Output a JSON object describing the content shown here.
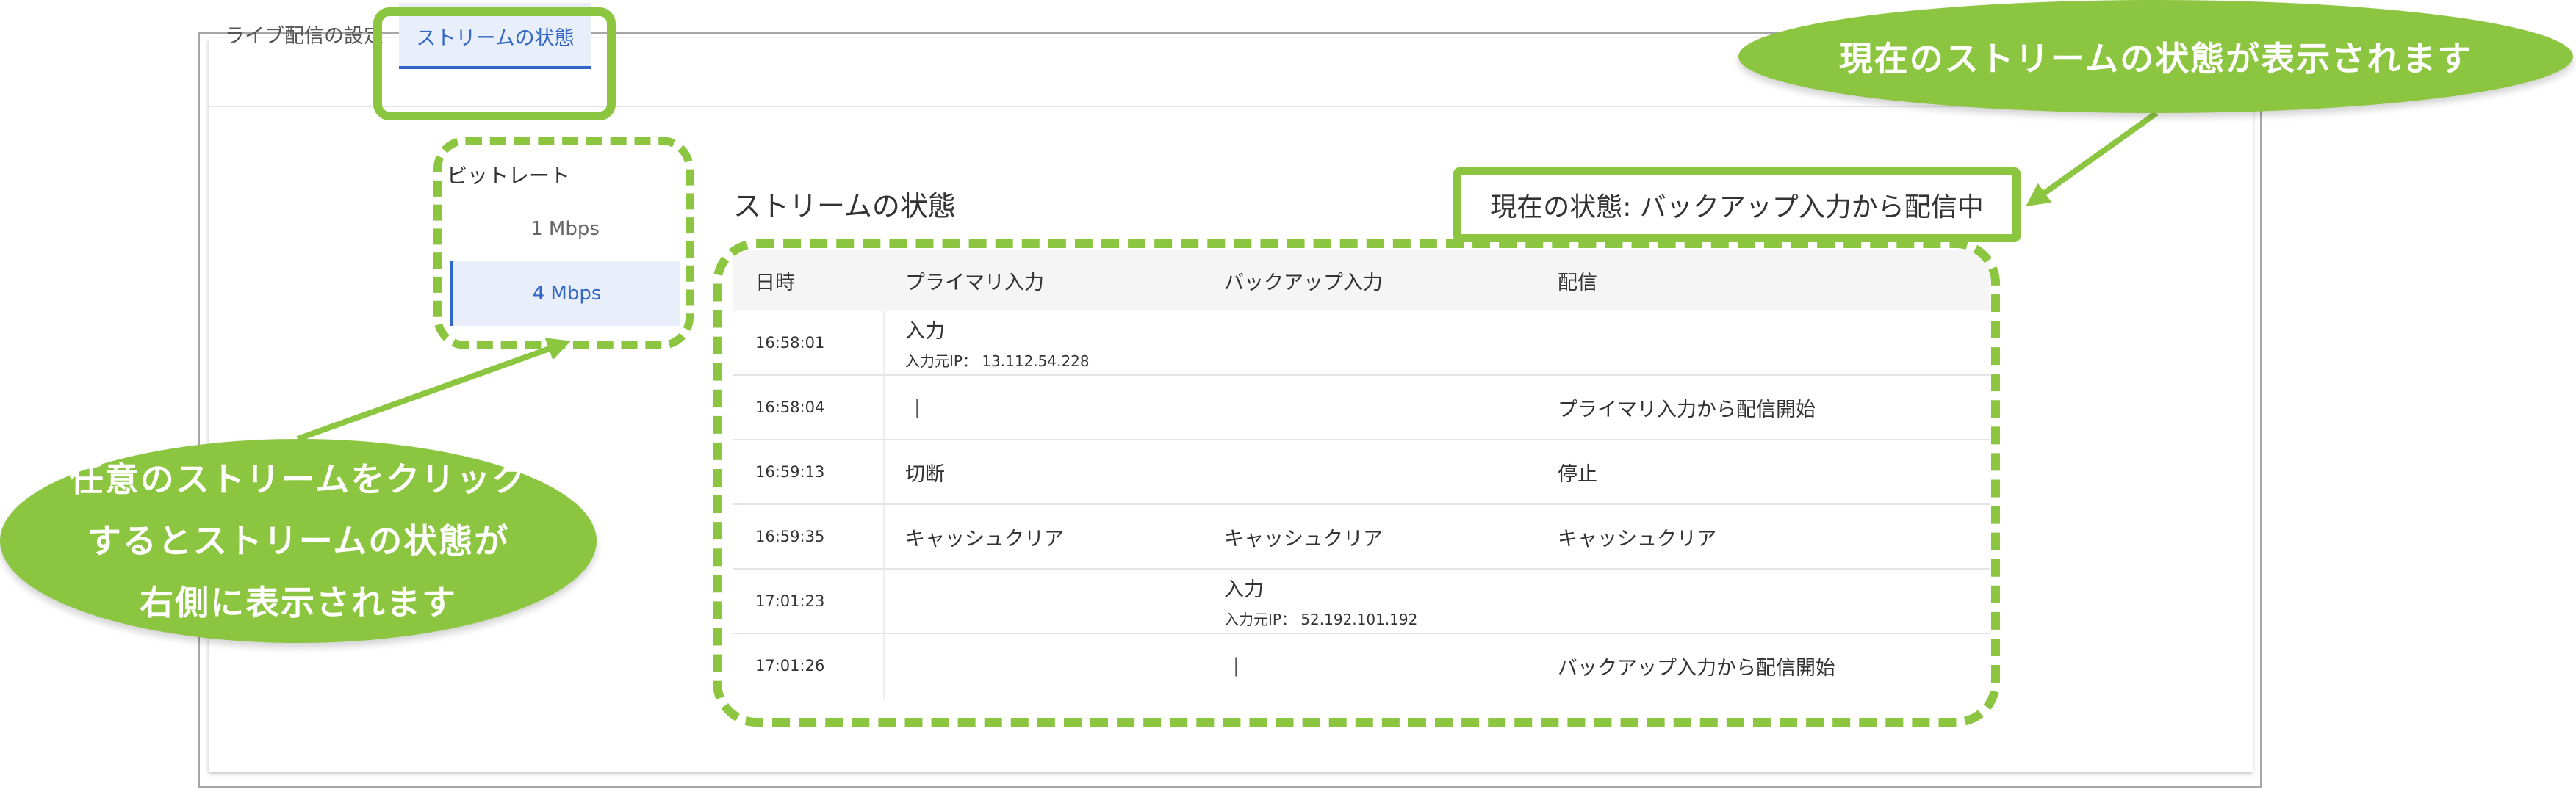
{
  "tabs": [
    {
      "label": "ライブ配信の設定"
    },
    {
      "label": "ストリームの状態"
    }
  ],
  "bitrate": {
    "label": "ビットレート",
    "options": [
      "1 Mbps",
      "4 Mbps"
    ],
    "selected": "4 Mbps"
  },
  "stream": {
    "title": "ストリームの状態",
    "current_status": "現在の状態: バックアップ入力から配信中",
    "columns": [
      "日時",
      "プライマリ入力",
      "バックアップ入力",
      "配信"
    ],
    "rows": [
      {
        "time": "16:58:01",
        "primary": "入力",
        "primary_sub": "入力元IP： 13.112.54.228",
        "backup": "",
        "backup_sub": "",
        "output": ""
      },
      {
        "time": "16:58:04",
        "primary": "|",
        "primary_sub": "",
        "backup": "",
        "backup_sub": "",
        "output": "プライマリ入力から配信開始"
      },
      {
        "time": "16:59:13",
        "primary": "切断",
        "primary_sub": "",
        "backup": "",
        "backup_sub": "",
        "output": "停止"
      },
      {
        "time": "16:59:35",
        "primary": "キャッシュクリア",
        "primary_sub": "",
        "backup": "キャッシュクリア",
        "backup_sub": "",
        "output": "キャッシュクリア"
      },
      {
        "time": "17:01:23",
        "primary": "",
        "primary_sub": "",
        "backup": "入力",
        "backup_sub": "入力元IP： 52.192.101.192",
        "output": ""
      },
      {
        "time": "17:01:26",
        "primary": "",
        "primary_sub": "",
        "backup": "|",
        "backup_sub": "",
        "output": "バックアップ入力から配信開始"
      }
    ]
  },
  "annotations": {
    "top_callout": "現在のストリームの状態が表示されます",
    "left_callout": [
      "任意のストリームをクリック",
      "するとストリームの状態が",
      "右側に表示されます"
    ],
    "accent_color": "#8cc641",
    "link_color": "#3266c8"
  }
}
